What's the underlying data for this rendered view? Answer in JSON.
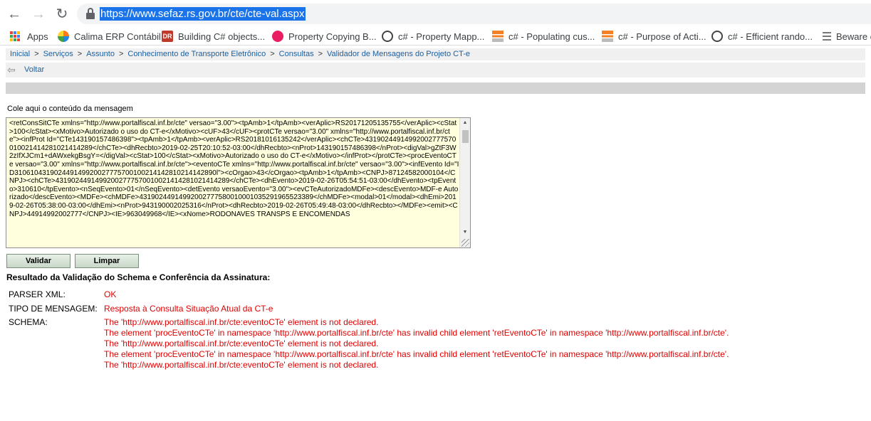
{
  "browser": {
    "url": "https://www.sefaz.rs.gov.br/cte/cte-val.aspx",
    "bookmarks": [
      {
        "label": "Apps",
        "icon": "apps-grid-icon"
      },
      {
        "label": "Calima ERP Contábil",
        "icon": "calima-icon",
        "color": "#ff7a1a"
      },
      {
        "label": "Building C# objects...",
        "icon": "dr-icon",
        "color": "#c0392b"
      },
      {
        "label": "Property Copying B...",
        "icon": "circle-icon",
        "color": "#e91e63"
      },
      {
        "label": "c# - Property Mapp...",
        "icon": "search-site-icon",
        "color": "#444444"
      },
      {
        "label": "c# - Populating cus...",
        "icon": "stackoverflow-icon",
        "color": "#f48024"
      },
      {
        "label": "c# - Purpose of Acti...",
        "icon": "stackoverflow-icon",
        "color": "#f48024"
      },
      {
        "label": "c# - Efficient rando...",
        "icon": "search-site-icon",
        "color": "#444444"
      },
      {
        "label": "Beware c",
        "icon": "list-icon",
        "color": "#777777"
      }
    ]
  },
  "breadcrumb": [
    "Inicial",
    "Serviços",
    "Assunto",
    "Conhecimento de Transporte Eletrônico",
    "Consultas",
    "Validador de Mensagens do Projeto CT-e"
  ],
  "breadcrumb_separator": ">",
  "back_label": "Voltar",
  "message_label": "Cole aqui o conteúdo da mensagem",
  "xml_content": "<retConsSitCTe xmlns=\"http://www.portalfiscal.inf.br/cte\" versao=\"3.00\"><tpAmb>1</tpAmb><verAplic>RS20171205135755</verAplic><cStat>100</cStat><xMotivo>Autorizado o uso do CT-e</xMotivo><cUF>43</cUF><protCTe versao=\"3.00\" xmlns=\"http://www.portalfiscal.inf.br/cte\"><infProt Id=\"CTe143190157486398\"><tpAmb>1</tpAmb><verAplic>RS20181016135242</verAplic><chCTe>43190244914992002777570010021414281021414289</chCTe><dhRecbto>2019-02-25T20:10:52-03:00</dhRecbto><nProt>143190157486398</nProt><digVal>gZtF3W2zIfXJCm1+dAWxekgBsgY=</digVal><cStat>100</cStat><xMotivo>Autorizado o uso do CT-e</xMotivo></infProt></protCTe><procEventoCTe versao=\"3.00\" xmlns=\"http://www.portalfiscal.inf.br/cte\"><eventoCTe xmlns=\"http://www.portalfiscal.inf.br/cte\" versao=\"3.00\"><infEvento Id=\"ID310610431902449149920027775700100214142810214142890l\"><cOrgao>43</cOrgao><tpAmb>1</tpAmb><CNPJ>87124582000104</CNPJ><chCTe>43190244914992002777570010021414281021414289</chCTe><dhEvento>2019-02-26T05:54:51-03:00</dhEvento><tpEvento>310610</tpEvento><nSeqEvento>01</nSeqEvento><detEvento versaoEvento=\"3.00\"><evCTeAutorizadoMDFe><descEvento>MDF-e Autorizado</descEvento><MDFe><chMDFe>43190244914992002777580010001035291965523389</chMDFe><modal>01</modal><dhEmi>2019-02-26T05:38:00-03:00</dhEmi><nProt>943190002025316</nProt><dhRecbto>2019-02-26T05:49:48-03:00</dhRecbto></MDFe><emit><CNPJ>44914992002777</CNPJ><IE>963049968</IE><xNome>RODONAVES TRANSPS E ENCOMENDAS",
  "buttons": {
    "validate": "Validar",
    "clear": "Limpar"
  },
  "result": {
    "title": "Resultado da Validação do Schema e Conferência da Assinatura:",
    "parser_label": "PARSER XML:",
    "parser_value": "OK",
    "type_label": "TIPO DE MENSAGEM:",
    "type_value": "Resposta à Consulta Situação Atual da CT-e",
    "schema_label": "SCHEMA:",
    "schema_errors": [
      "The 'http://www.portalfiscal.inf.br/cte:eventoCTe' element is not declared.",
      "The element 'procEventoCTe' in namespace 'http://www.portalfiscal.inf.br/cte' has invalid child element 'retEventoCTe' in namespace 'http://www.portalfiscal.inf.br/cte'.",
      "The 'http://www.portalfiscal.inf.br/cte:eventoCTe' element is not declared.",
      "The element 'procEventoCTe' in namespace 'http://www.portalfiscal.inf.br/cte' has invalid child element 'retEventoCTe' in namespace 'http://www.portalfiscal.inf.br/cte'.",
      "The 'http://www.portalfiscal.inf.br/cte:eventoCTe' element is not declared."
    ]
  },
  "colors": {
    "link": "#1d5e9e",
    "error": "#e00000",
    "textarea_bg": "#ffffdd",
    "url_highlight": "#1a73e8"
  }
}
